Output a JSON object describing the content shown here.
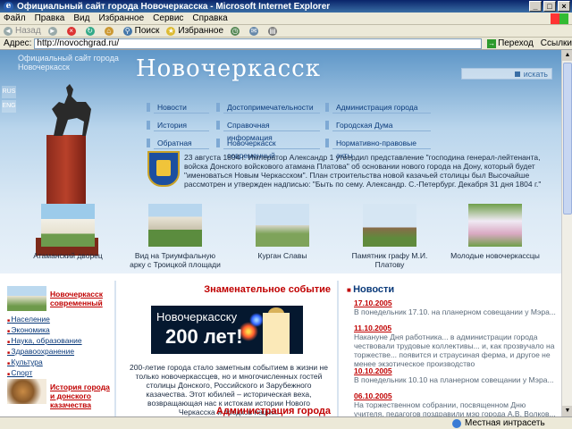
{
  "window": {
    "title": "Официальный сайт города Новочеркасска - Microsoft Internet Explorer",
    "buttons": [
      "_",
      "□",
      "×"
    ]
  },
  "menu": [
    "Файл",
    "Правка",
    "Вид",
    "Избранное",
    "Сервис",
    "Справка"
  ],
  "toolbar": {
    "back": "Назад",
    "search": "Поиск",
    "favorites": "Избранное"
  },
  "address": {
    "label": "Адрес:",
    "url": "http://novochgrad.ru/",
    "go": "Переход",
    "links": "Ссылки"
  },
  "site": {
    "tagline": "Официальный сайт города Новочеркасск",
    "title": "Новочеркасск",
    "search_label": "искать",
    "languages": [
      "RUS",
      "ENG"
    ],
    "nav": [
      "Новости",
      "Достопримечательности",
      "Администрация города",
      "История",
      "Справочная информация",
      "Городская Дума",
      "Обратная связь",
      "Новочеркасск современный",
      "Нормативно-правовые акты"
    ],
    "history_text": "23 августа 1804 г. Император Александр 1 утвердил представление \"господина генерал-лейтенанта, войска Донского войскового атамана Платова\" об основании нового города на Дону, который будет \"именоваться Новым Черкасском\". План строительства новой казачьей столицы был Высочайше рассмотрен и утвержден надписью: \"Быть по сему. Александр. С.-Петербург. Декабря 31 дня 1804 г.\"",
    "photos": [
      "Атаманский дворец",
      "Вид на Триумфальную арку с Троицкой площади",
      "Курган Славы",
      "Памятник графу М.И. Платову",
      "Молодые новочеркассцы"
    ]
  },
  "left": {
    "block1_title": "Новочеркасск современный",
    "block1_items": [
      "Население",
      "Экономика",
      "Наука, образование",
      "Здравоохранение",
      "Культура",
      "Спорт"
    ],
    "block2_title": "История города и донского казачества"
  },
  "middle": {
    "heading": "Знаменательное событие",
    "banner_line1": "Новочеркасску",
    "banner_line2": "200 лет!",
    "text": "200-летие города стало заметным событием в жизни не только новочеркассцев, но и многочисленных гостей столицы Донского, Российского и Зарубежного казачества. Этот юбилей – историческая веха, возвращающая нас к истокам истории Нового Черкасска и предков наших.",
    "heading2": "Администрация города"
  },
  "news": {
    "heading": "Новости",
    "items": [
      {
        "date": "17.10.2005",
        "text": "В понедельник 17.10. на планерном совещании у Мэра..."
      },
      {
        "date": "11.10.2005",
        "text": "Накануне Дня работника... в администрации города чествовали трудовые коллективы... и, как прозвучало на торжестве... появится и страусиная ферма, и другое не менее экзотическое производство"
      },
      {
        "date": "10.10.2005",
        "text": "В понедельник 10.10 на планерном совещании у Мэра..."
      },
      {
        "date": "06.10.2005",
        "text": "На торжественном собрании, посвященном Дню учителя, педагогов поздравили мэр города А.В. Волков..."
      }
    ]
  },
  "status": {
    "done": "",
    "zone": "Местная интрасеть"
  },
  "colors": {
    "accent_red": "#c00000",
    "link_blue": "#0a3a7a",
    "header_blue": "#5f97c8"
  }
}
